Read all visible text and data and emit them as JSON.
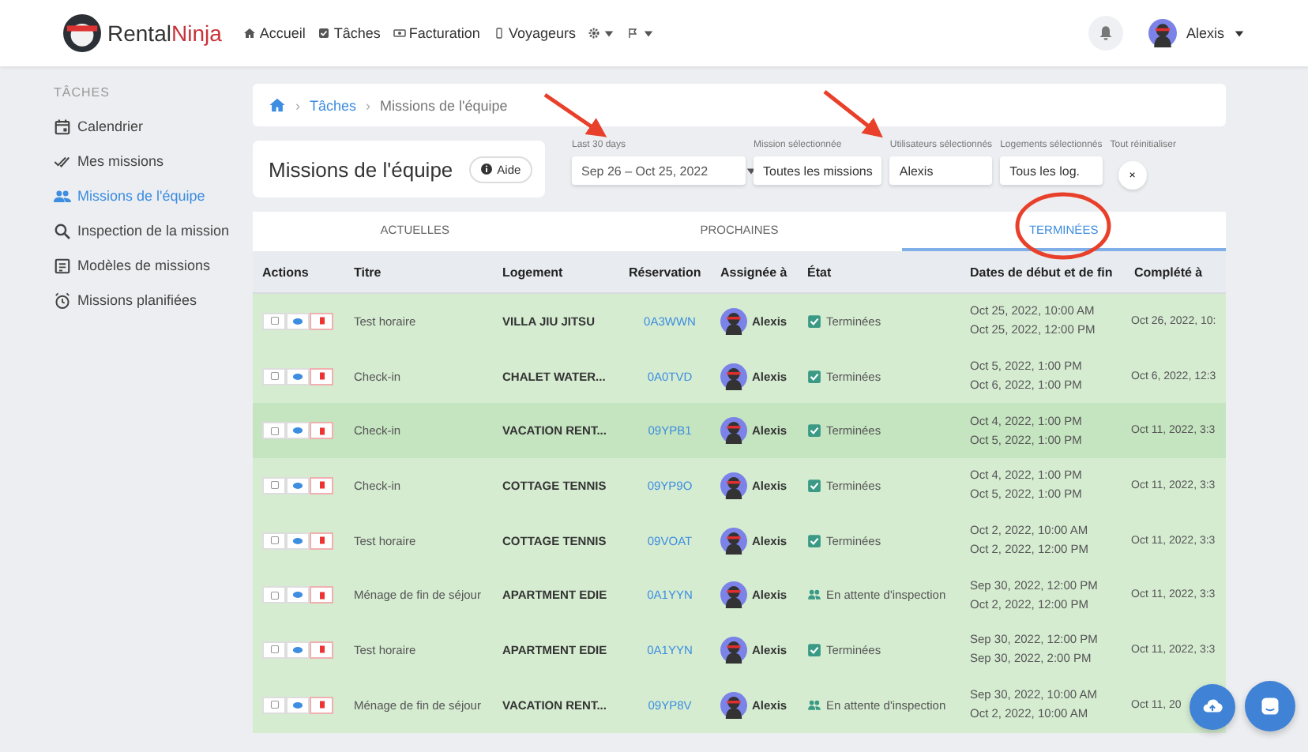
{
  "brand": {
    "first": "Rental",
    "second": "Ninja"
  },
  "nav": [
    {
      "label": "Accueil"
    },
    {
      "label": "Tâches"
    },
    {
      "label": "Facturation"
    },
    {
      "label": "Voyageurs"
    }
  ],
  "user": {
    "name": "Alexis"
  },
  "sidebar": {
    "heading": "TÂCHES",
    "items": [
      {
        "label": "Calendrier",
        "selected": false
      },
      {
        "label": "Mes missions",
        "selected": false
      },
      {
        "label": "Missions de l'équipe",
        "selected": true
      },
      {
        "label": "Inspection de la mission",
        "selected": false
      },
      {
        "label": "Modèles de missions",
        "selected": false
      },
      {
        "label": "Missions planifiées",
        "selected": false
      }
    ]
  },
  "breadcrumb": [
    {
      "separator": "›",
      "label": "Tâches"
    },
    {
      "separator": "›",
      "label": "Missions de l'équipe"
    }
  ],
  "page_title": "Missions de l'équipe",
  "help_button": "Aide",
  "filters": [
    {
      "kind": "dropdown",
      "label": "Last 30 days",
      "value": "Sep 26 – Oct 25, 2022"
    },
    {
      "kind": "button",
      "label": "Mission sélectionnée",
      "value": "Toutes les missions"
    },
    {
      "kind": "button",
      "label": "Utilisateurs sélectionnés",
      "value": "Alexis"
    },
    {
      "kind": "button",
      "label": "Logements sélectionnés",
      "value": "Tous les log."
    },
    {
      "kind": "reset",
      "label": "Tout réinitialiser",
      "value": "×"
    }
  ],
  "tabs": [
    {
      "label": "ACTUELLES",
      "selected": false
    },
    {
      "label": "PROCHAINES",
      "selected": false
    },
    {
      "label": "TERMINÉES",
      "selected": true
    }
  ],
  "table": {
    "columns": [
      "Actions",
      "Titre",
      "Logement",
      "Réservation",
      "Assignée à",
      "État",
      "Dates de début et de fin",
      "Complété à"
    ],
    "rows": [
      {
        "highlighted": false,
        "title": "Test horaire",
        "property": "VILLA JIU JITSU",
        "reservation": "0A3WWN",
        "assignee": "Alexis",
        "status": {
          "kind": "done",
          "label": "Terminées"
        },
        "start": "Oct 25, 2022, 10:00 AM",
        "end": "Oct 25, 2022, 12:00 PM",
        "completed": "Oct 26, 2022, 10:"
      },
      {
        "highlighted": false,
        "title": "Check-in",
        "property": "CHALET WATER...",
        "reservation": "0A0TVD",
        "assignee": "Alexis",
        "status": {
          "kind": "done",
          "label": "Terminées"
        },
        "start": "Oct 5, 2022, 1:00 PM",
        "end": "Oct 6, 2022, 1:00 PM",
        "completed": "Oct 6, 2022, 12:3"
      },
      {
        "highlighted": true,
        "title": "Check-in",
        "property": "VACATION RENT...",
        "reservation": "09YPB1",
        "assignee": "Alexis",
        "status": {
          "kind": "done",
          "label": "Terminées"
        },
        "start": "Oct 4, 2022, 1:00 PM",
        "end": "Oct 5, 2022, 1:00 PM",
        "completed": "Oct 11, 2022, 3:3"
      },
      {
        "highlighted": false,
        "title": "Check-in",
        "property": "COTTAGE TENNIS",
        "reservation": "09YP9O",
        "assignee": "Alexis",
        "status": {
          "kind": "done",
          "label": "Terminées"
        },
        "start": "Oct 4, 2022, 1:00 PM",
        "end": "Oct 5, 2022, 1:00 PM",
        "completed": "Oct 11, 2022, 3:3"
      },
      {
        "highlighted": false,
        "title": "Test horaire",
        "property": "COTTAGE TENNIS",
        "reservation": "09VOAT",
        "assignee": "Alexis",
        "status": {
          "kind": "done",
          "label": "Terminées"
        },
        "start": "Oct 2, 2022, 10:00 AM",
        "end": "Oct 2, 2022, 12:00 PM",
        "completed": "Oct 11, 2022, 3:3"
      },
      {
        "highlighted": false,
        "title": "Ménage de fin de séjour",
        "property": "APARTMENT EDIE",
        "reservation": "0A1YYN",
        "assignee": "Alexis",
        "status": {
          "kind": "inspection",
          "label": "En attente d'inspection"
        },
        "start": "Sep 30, 2022, 12:00 PM",
        "end": "Oct 2, 2022, 12:00 PM",
        "completed": "Oct 11, 2022, 3:3"
      },
      {
        "highlighted": false,
        "title": "Test horaire",
        "property": "APARTMENT EDIE",
        "reservation": "0A1YYN",
        "assignee": "Alexis",
        "status": {
          "kind": "done",
          "label": "Terminées"
        },
        "start": "Sep 30, 2022, 12:00 PM",
        "end": "Sep 30, 2022, 2:00 PM",
        "completed": "Oct 11, 2022, 3:3"
      },
      {
        "highlighted": false,
        "title": "Ménage de fin de séjour",
        "property": "VACATION RENT...",
        "reservation": "09YP8V",
        "assignee": "Alexis",
        "status": {
          "kind": "inspection",
          "label": "En attente d'inspection"
        },
        "start": "Sep 30, 2022, 10:00 AM",
        "end": "Oct 2, 2022, 10:00 AM",
        "completed": "Oct 11, 20"
      }
    ]
  }
}
